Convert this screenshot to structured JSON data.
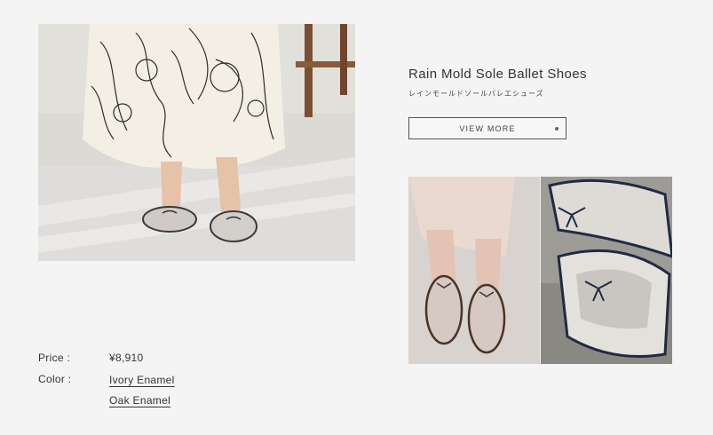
{
  "product": {
    "title": "Rain Mold Sole Ballet Shoes",
    "subtitle_jp": "レインモールドソールバレエシューズ",
    "view_more_label": "VIEW MORE"
  },
  "details": {
    "price_label": "Price :",
    "price_value": "¥8,910",
    "color_label": "Color :",
    "colors": [
      "Ivory Enamel",
      "Oak Enamel"
    ]
  },
  "images": {
    "hero": "model-standing-ballet-shoes-photo",
    "thumb_1": "model-feet-ballet-shoes-photo",
    "thumb_2": "shoe-closeup-bow-photo"
  }
}
